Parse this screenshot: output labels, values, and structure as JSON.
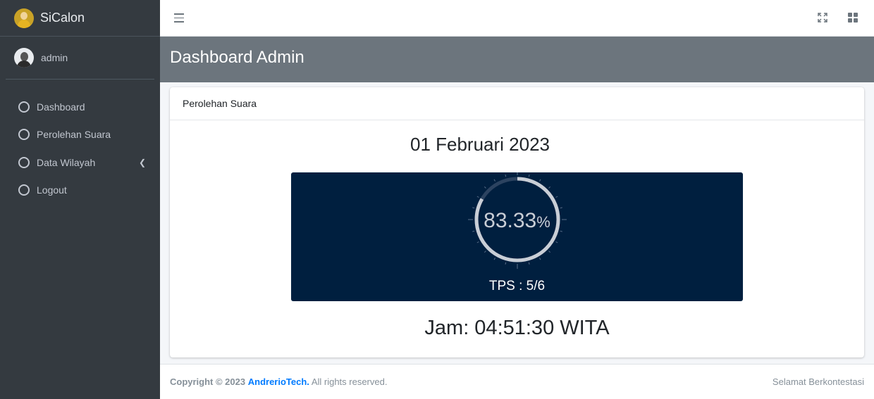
{
  "app": {
    "name": "SiCalon",
    "logo_icon": "candidate-logo-icon"
  },
  "user": {
    "name": "admin",
    "avatar_icon": "user-avatar-icon"
  },
  "sidebar": {
    "items": [
      {
        "label": "Dashboard",
        "icon": "circle-icon"
      },
      {
        "label": "Perolehan Suara",
        "icon": "circle-icon"
      },
      {
        "label": "Data Wilayah",
        "icon": "circle-icon",
        "chevron": "chevron-left-icon"
      },
      {
        "label": "Logout",
        "icon": "circle-icon"
      }
    ]
  },
  "topbar": {
    "menu_icon": "hamburger-icon",
    "fullscreen_icon": "expand-icon",
    "apps_icon": "grid-icon"
  },
  "header": {
    "title": "Dashboard Admin"
  },
  "card": {
    "title": "Perolehan Suara",
    "date": "01 Februari 2023",
    "gauge": {
      "value": "83.33",
      "unit": "%",
      "fraction": 0.8333,
      "tps_label": "TPS : 5/6"
    },
    "clock": "Jam: 04:51:30 WITA"
  },
  "footer": {
    "copyright_prefix": "Copyright © 2023",
    "brand": "AndrerioTech.",
    "rights": "All rights reserved.",
    "tagline": "Selamat Berkontestasi"
  },
  "colors": {
    "sidebar_bg": "#343a40",
    "header_bg": "#6c757d",
    "gauge_bg": "#001f3f",
    "link": "#007bff"
  }
}
